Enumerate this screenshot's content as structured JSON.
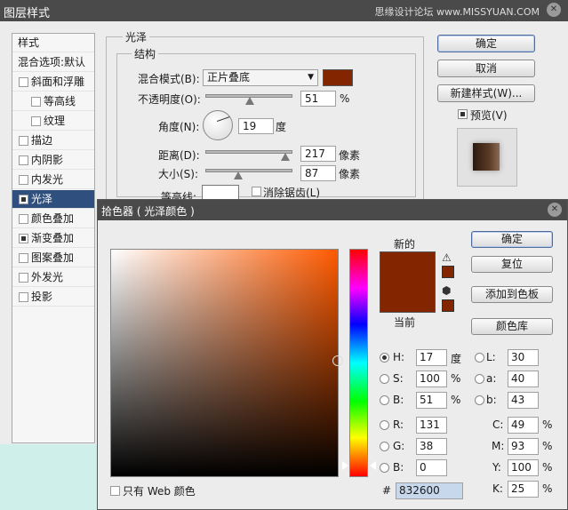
{
  "layer_style": {
    "title": "图层样式",
    "watermark": "思缘设计论坛 www.MISSYUAN.COM",
    "sidebar": [
      {
        "label": "样式",
        "type": "head"
      },
      {
        "label": "混合选项:默认",
        "type": "head"
      },
      {
        "label": "斜面和浮雕",
        "checked": false
      },
      {
        "label": "等高线",
        "checked": false,
        "sub": true
      },
      {
        "label": "纹理",
        "checked": false,
        "sub": true
      },
      {
        "label": "描边",
        "checked": false
      },
      {
        "label": "内阴影",
        "checked": false
      },
      {
        "label": "内发光",
        "checked": false
      },
      {
        "label": "光泽",
        "checked": true,
        "active": true
      },
      {
        "label": "颜色叠加",
        "checked": false
      },
      {
        "label": "渐变叠加",
        "checked": true
      },
      {
        "label": "图案叠加",
        "checked": false
      },
      {
        "label": "外发光",
        "checked": false
      },
      {
        "label": "投影",
        "checked": false
      }
    ],
    "satin_group": "光泽",
    "structure_group": "结构",
    "blend_mode_label": "混合模式(B):",
    "blend_mode_value": "正片叠底",
    "opacity_label": "不透明度(O):",
    "opacity_value": "51",
    "opacity_unit": "%",
    "angle_label": "角度(N):",
    "angle_value": "19",
    "angle_unit": "度",
    "distance_label": "距离(D):",
    "distance_value": "217",
    "distance_unit": "像素",
    "size_label": "大小(S):",
    "size_value": "87",
    "size_unit": "像素",
    "contour_label": "等高线:",
    "antialias_label": "消除锯齿(L)",
    "buttons": {
      "ok": "确定",
      "cancel": "取消",
      "new_style": "新建样式(W)...",
      "preview": "预览(V)"
    },
    "satin_color": "#832600"
  },
  "color_picker": {
    "title": "拾色器 ( 光泽颜色 )",
    "new_label": "新的",
    "current_label": "当前",
    "buttons": {
      "ok": "确定",
      "reset": "复位",
      "add_swatches": "添加到色板",
      "libraries": "颜色库"
    },
    "hsb": {
      "h": "17",
      "s": "100",
      "b": "51",
      "h_unit": "度",
      "s_unit": "%",
      "b_unit": "%"
    },
    "lab": {
      "l": "30",
      "a": "40",
      "b": "43"
    },
    "rgb": {
      "r": "131",
      "g": "38",
      "b": "0"
    },
    "cmyk": {
      "c": "49",
      "m": "93",
      "y": "100",
      "k": "25",
      "unit": "%"
    },
    "labels": {
      "h": "H:",
      "s": "S:",
      "b": "B:",
      "l": "L:",
      "a": "a:",
      "lab_b": "b:",
      "r": "R:",
      "g": "G:",
      "rgb_b": "B:",
      "c": "C:",
      "m": "M:",
      "y": "Y:",
      "k": "K:",
      "hex": "#"
    },
    "hex": "832600",
    "web_only_label": "只有 Web 颜色",
    "new_color": "#832600",
    "current_color": "#832600"
  }
}
